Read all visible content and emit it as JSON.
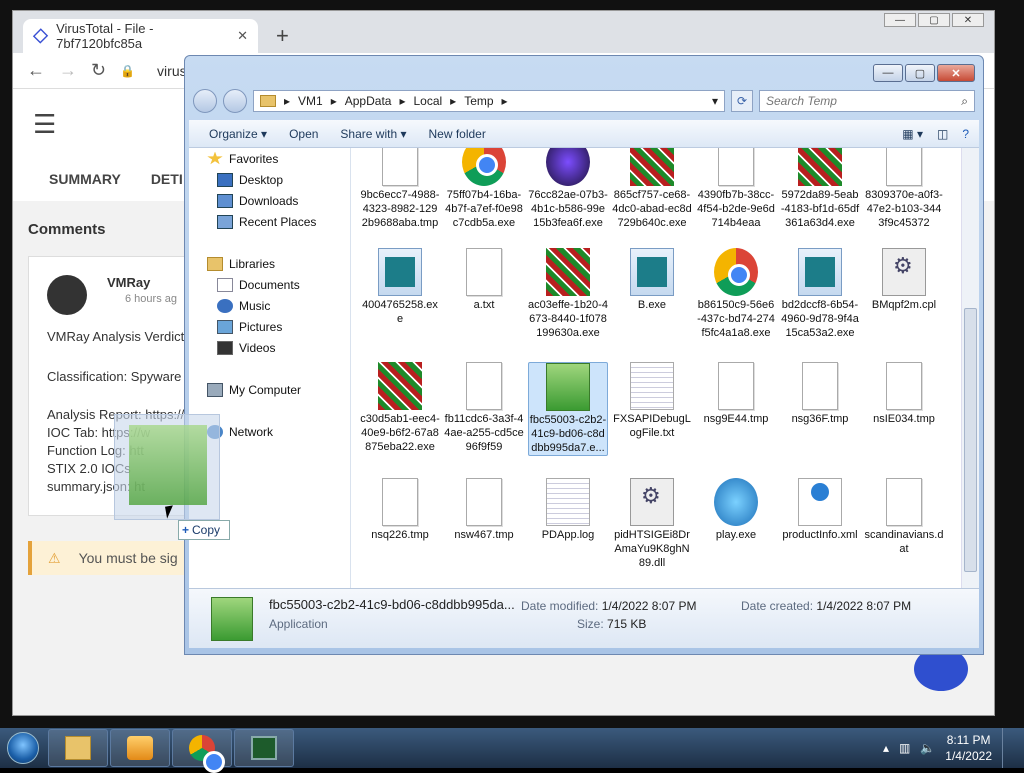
{
  "chrome": {
    "tab_title": "VirusTotal - File - 7bf7120bfc85a",
    "url": "virus",
    "new_tab": "+"
  },
  "vt": {
    "tabs": [
      "SUMMARY",
      "DETI"
    ],
    "comments_title": "Comments",
    "author": "VMRay",
    "time": "6 hours ag",
    "lines": [
      "VMRay Analysis Verdict:",
      "Classification: Spyware",
      "Analysis Report: https://",
      "IOC Tab: https://w",
      "Function Log: htt",
      "STIX 2.0 IOCs",
      "summary.json: ht"
    ],
    "warning": "You must be sig"
  },
  "explorer": {
    "breadcrumb": [
      "VM1",
      "AppData",
      "Local",
      "Temp"
    ],
    "search_placeholder": "Search Temp",
    "toolbar": [
      "Organize ▾",
      "Open",
      "Share with ▾",
      "New folder"
    ],
    "nav": [
      {
        "label": "Favorites",
        "icon": "star-icon"
      },
      {
        "label": "Desktop",
        "icon": "desktop-icon"
      },
      {
        "label": "Downloads",
        "icon": "downloads-icon"
      },
      {
        "label": "Recent Places",
        "icon": "recent-icon"
      },
      {
        "label": "Libraries",
        "icon": "libraries-icon"
      },
      {
        "label": "Documents",
        "icon": "documents-icon"
      },
      {
        "label": "Music",
        "icon": "music-icon"
      },
      {
        "label": "Pictures",
        "icon": "pictures-icon"
      },
      {
        "label": "Videos",
        "icon": "videos-icon"
      },
      {
        "label": "My Computer",
        "icon": "computer-icon"
      },
      {
        "label": "Network",
        "icon": "network-icon"
      }
    ],
    "files": [
      {
        "name": "9bc6ecc7-4988-4323-8982-1292b9688aba.tmp",
        "icon": "doc"
      },
      {
        "name": "75ff07b4-16ba-4b7f-a7ef-f0e98c7cdb5a.exe",
        "icon": "chrome"
      },
      {
        "name": "76cc82ae-07b3-4b1c-b586-99e15b3fea6f.exe",
        "icon": "dark"
      },
      {
        "name": "865cf757-ce68-4dc0-abad-ec8d729b640c.exe",
        "icon": "noise"
      },
      {
        "name": "4390fb7b-38cc-4f54-b2de-9e6d714b4eaa",
        "icon": "doc"
      },
      {
        "name": "5972da89-5eab-4183-bf1d-65df361a63d4.exe",
        "icon": "noise"
      },
      {
        "name": "8309370e-a0f3-47e2-b103-3443f9c45372",
        "icon": "doc"
      },
      {
        "name": "4004765258.exe",
        "icon": "app"
      },
      {
        "name": "a.txt",
        "icon": "doc"
      },
      {
        "name": "ac03effe-1b20-4673-8440-1f078199630a.exe",
        "icon": "noise"
      },
      {
        "name": "B.exe",
        "icon": "app"
      },
      {
        "name": "b86150c9-56e6-437c-bd74-274f5fc4a1a8.exe",
        "icon": "chrome"
      },
      {
        "name": "bd2dccf8-6b54-4960-9d78-9f4a15ca53a2.exe",
        "icon": "app"
      },
      {
        "name": "BMqpf2m.cpl",
        "icon": "gear"
      },
      {
        "name": "c30d5ab1-eec4-40e9-b6f2-67a8875eba22.exe",
        "icon": "noise"
      },
      {
        "name": "fb11cdc6-3a3f-44ae-a255-cd5ce96f9f59",
        "icon": "doc"
      },
      {
        "name": "fbc55003-c2b2-41c9-bd06-c8ddbb995da7.e...",
        "icon": "setup",
        "selected": true
      },
      {
        "name": "FXSAPIDebugLogFile.txt",
        "icon": "log"
      },
      {
        "name": "nsg9E44.tmp",
        "icon": "doc"
      },
      {
        "name": "nsg36F.tmp",
        "icon": "doc"
      },
      {
        "name": "nsIE034.tmp",
        "icon": "doc"
      },
      {
        "name": "nsq226.tmp",
        "icon": "doc"
      },
      {
        "name": "nsw467.tmp",
        "icon": "doc"
      },
      {
        "name": "PDApp.log",
        "icon": "log"
      },
      {
        "name": "pidHTSIGEi8DrAmaYu9K8ghN89.dll",
        "icon": "gear"
      },
      {
        "name": "play.exe",
        "icon": "play"
      },
      {
        "name": "productInfo.xml",
        "icon": "xml"
      },
      {
        "name": "scandinavians.dat",
        "icon": "doc"
      }
    ],
    "details": {
      "name": "fbc55003-c2b2-41c9-bd06-c8ddbb995da...",
      "type": "Application",
      "modified_label": "Date modified:",
      "modified": "1/4/2022 8:07 PM",
      "size_label": "Size:",
      "size": "715 KB",
      "created_label": "Date created:",
      "created": "1/4/2022 8:07 PM"
    }
  },
  "drag": {
    "copy_label": "Copy"
  },
  "taskbar": {
    "time": "8:11 PM",
    "date": "1/4/2022"
  }
}
